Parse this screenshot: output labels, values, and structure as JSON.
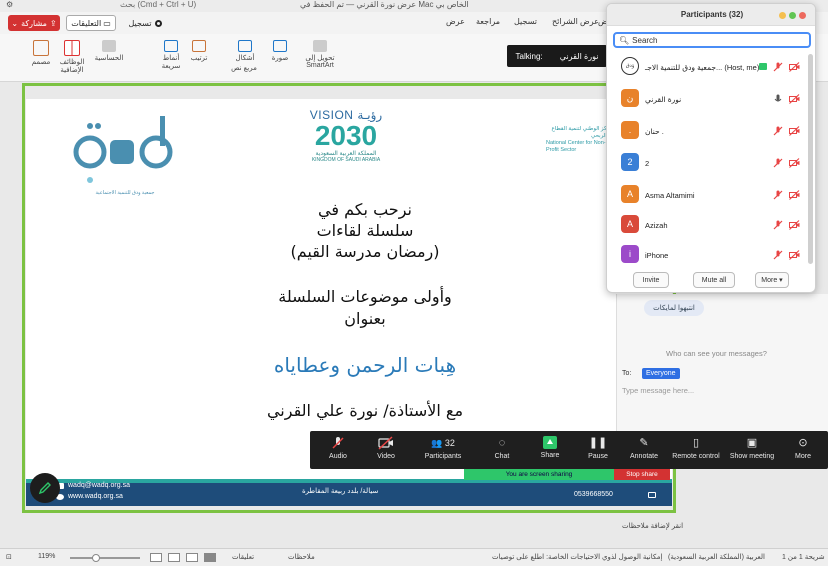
{
  "titlebar": {
    "search_hint": "(Cmd + Ctrl + U) بحث",
    "doc_title": "عرض نورة القرني — تم الحفظ في Mac الخاص بي"
  },
  "ribbon_tabs": {
    "share": "مشاركة",
    "comments": "التعليقات",
    "record": "تسجيل",
    "tabs": [
      "عرض",
      "مراجعة",
      "تسجيل",
      "عرض الشرائح",
      "عرض"
    ]
  },
  "ribbon": {
    "designer": "مصمم",
    "addins": "الوظائف الإضافية",
    "sensitivity": "الحساسية",
    "arrange": "ترتيب",
    "quick_styles": "أنماط سريعة",
    "shapes": "أشكال",
    "picture": "صورة",
    "textbox": "مربع نص",
    "smartart": "تحويل إلى SmartArt"
  },
  "talking": {
    "label": "Talking:",
    "name": "نورة القرني"
  },
  "slide": {
    "wadq_sub": "جمعية ودق للتنمية الاجتماعية",
    "vision_top": "VISION رؤيـة",
    "vision_year": "2030",
    "vision_ar": "المملكة العربية السعودية",
    "vision_en": "KINGDOM OF SAUDI ARABIA",
    "ncnp_ar": "المركز الوطني لتنمية القطاع غير الربحي",
    "ncnp_en": "National Center for Non-Profit Sector",
    "line1": "نرحب بكم في",
    "line2": "سلسلة لقاءات",
    "line3": "(رمضان مدرسة القيم)",
    "line4": "وأولى موضوعات السلسلة",
    "line5": "بعنوان",
    "line6": "هِبات الرحمن وعطاياه",
    "line7": "مع الأستاذة/ نورة علي القرني",
    "email": "wadq@wadq.org.sa",
    "web": "www.wadq.org.sa",
    "address": "سيالة/ بلدد ربيعة المقاطرة",
    "phone": "0539668550"
  },
  "chat": {
    "bubble": "انتبهوا لمايكات",
    "who_can_see": "Who can see your messages?",
    "to_label": "To:",
    "to_value": "Everyone",
    "input_placeholder": "Type message here..."
  },
  "zoom_toolbar": {
    "audio": "Audio",
    "video": "Video",
    "participants": "Participants",
    "participants_count": "32",
    "chat": "Chat",
    "share": "Share",
    "pause": "Pause",
    "annotate": "Annotate",
    "remote": "Remote control",
    "show_meeting": "Show meeting",
    "more": "More",
    "sharing_status": "You are screen sharing",
    "stop_share": "Stop share"
  },
  "participants": {
    "title": "Participants (32)",
    "search_placeholder": "Search",
    "list": [
      {
        "name": "جمعية ودق للتنمية الاجـ... (Host, me)",
        "avatar": "",
        "color": "#ffffff"
      },
      {
        "name": "نورة القرني",
        "avatar": "ن",
        "color": "#e8822a"
      },
      {
        "name": "حنان .",
        "avatar": ".",
        "color": "#e8822a"
      },
      {
        "name": "2",
        "avatar": "2",
        "color": "#3a7fd6"
      },
      {
        "name": "Asma Altamimi",
        "avatar": "A",
        "color": "#e8822a"
      },
      {
        "name": "Azizah",
        "avatar": "A",
        "color": "#d94a3a"
      },
      {
        "name": "iPhone",
        "avatar": "i",
        "color": "#9c4ac9"
      }
    ],
    "invite": "Invite",
    "mute_all": "Mute all",
    "more": "More"
  },
  "notes": {
    "placeholder": "انقر لإضافة ملاحظات"
  },
  "statusbar": {
    "zoom": "119%",
    "notes": "ملاحظات",
    "comments": "تعليقات",
    "slide": "شريحة 1 من 1",
    "lang": "العربية (المملكة العربية السعودية)",
    "accessibility": "إمكانية الوصول لذوي الاحتياجات الخاصة: اطلع على توصيات"
  },
  "colors": {
    "frame_green": "#7cc242",
    "share_red": "#d33232",
    "zoom_dark": "#1f1f1f",
    "search_blue": "#4a8df6"
  }
}
